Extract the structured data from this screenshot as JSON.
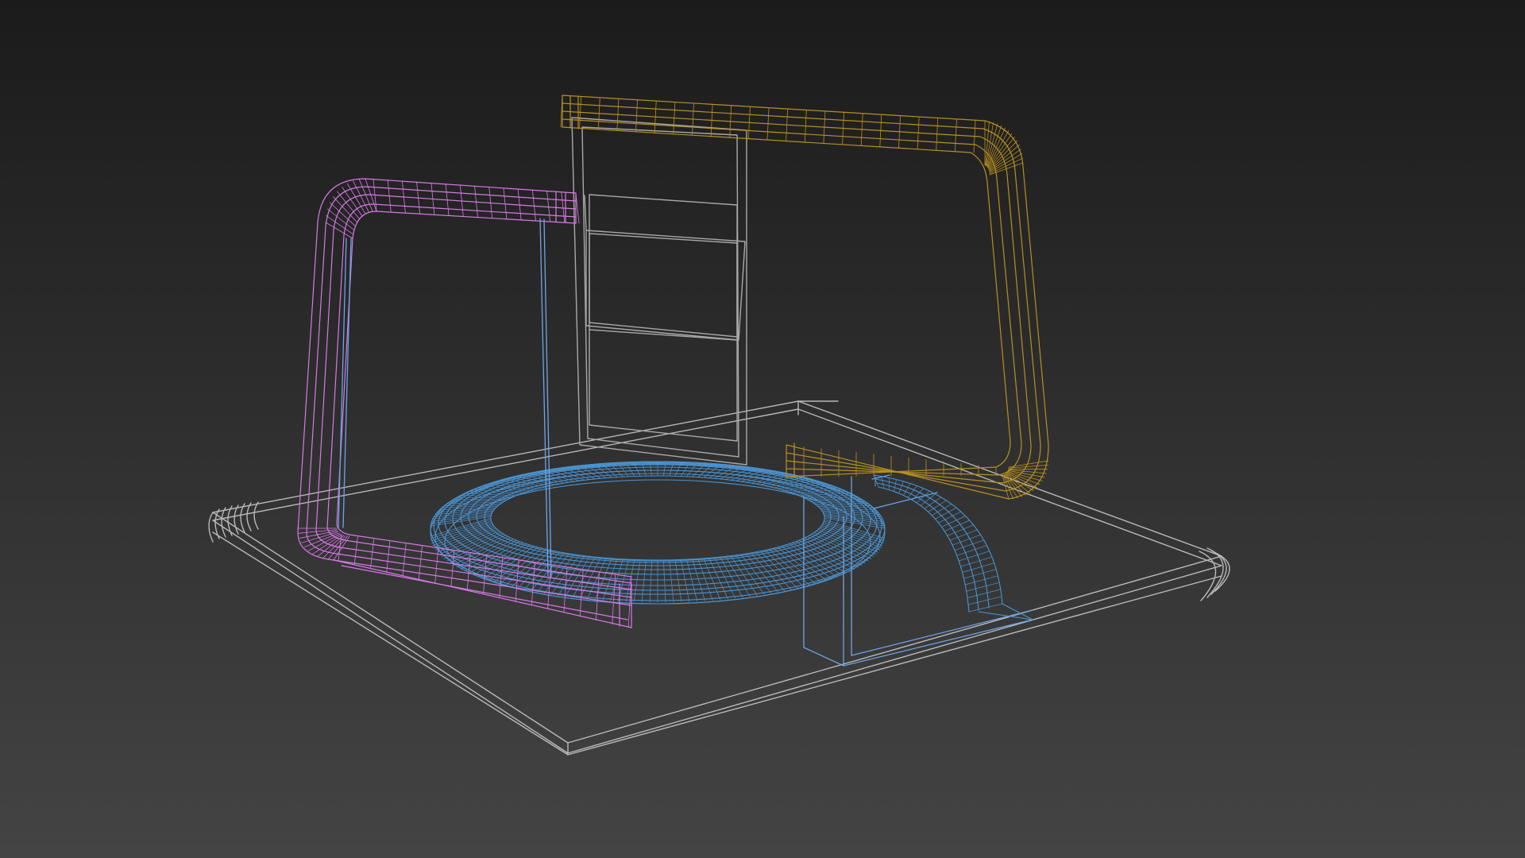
{
  "viewport": {
    "background_top": "#1b1b1b",
    "background_bottom": "#444444"
  },
  "colors": {
    "base_plate": "#b9b9b9",
    "door_panel": "#a9a9a9",
    "magenta_frame": "#d879e6",
    "gold_frame": "#b8901f",
    "blue_ring": "#4b93cf",
    "blue_frame": "#6fa3e8"
  },
  "objects": [
    {
      "name": "base-plate",
      "color_key": "base_plate"
    },
    {
      "name": "door-panel",
      "color_key": "door_panel"
    },
    {
      "name": "magenta-tube-frame",
      "color_key": "magenta_frame"
    },
    {
      "name": "gold-tube-frame",
      "color_key": "gold_frame"
    },
    {
      "name": "blue-torus-ring",
      "color_key": "blue_ring"
    },
    {
      "name": "blue-arc-segment",
      "color_key": "blue_ring"
    },
    {
      "name": "blue-box-frame",
      "color_key": "blue_frame"
    }
  ]
}
